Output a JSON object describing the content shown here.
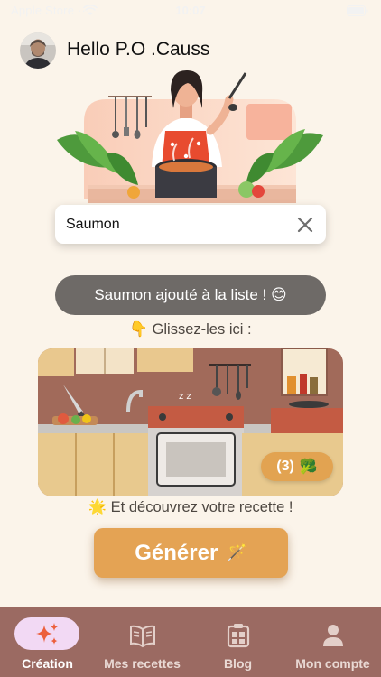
{
  "status_bar": {
    "carrier": "Apple Store ···",
    "time": "10:07"
  },
  "header": {
    "greeting": "Hello P.O .Causs"
  },
  "search": {
    "value": "Saumon",
    "placeholder": ""
  },
  "toast": {
    "text": "Saumon ajouté à la liste ! 😊"
  },
  "hints": {
    "drag_here": "👇 Glissez-les ici :",
    "discover": "🌟 Et découvrez votre recette !"
  },
  "ingredients_badge": {
    "count_text": "(3)",
    "emoji": "🥦"
  },
  "generate": {
    "label": "Générer",
    "emoji": "🪄"
  },
  "tabs": [
    {
      "label": "Création",
      "icon": "sparkles-icon",
      "active": true
    },
    {
      "label": "Mes recettes",
      "icon": "book-icon",
      "active": false
    },
    {
      "label": "Blog",
      "icon": "newspaper-icon",
      "active": false
    },
    {
      "label": "Mon compte",
      "icon": "user-icon",
      "active": false
    }
  ],
  "colors": {
    "background": "#fbf4ea",
    "accent": "#e4a354",
    "toast": "#6e6a67",
    "tab_bar": "#9b6a62",
    "active_pill": "#f2d9f4"
  }
}
